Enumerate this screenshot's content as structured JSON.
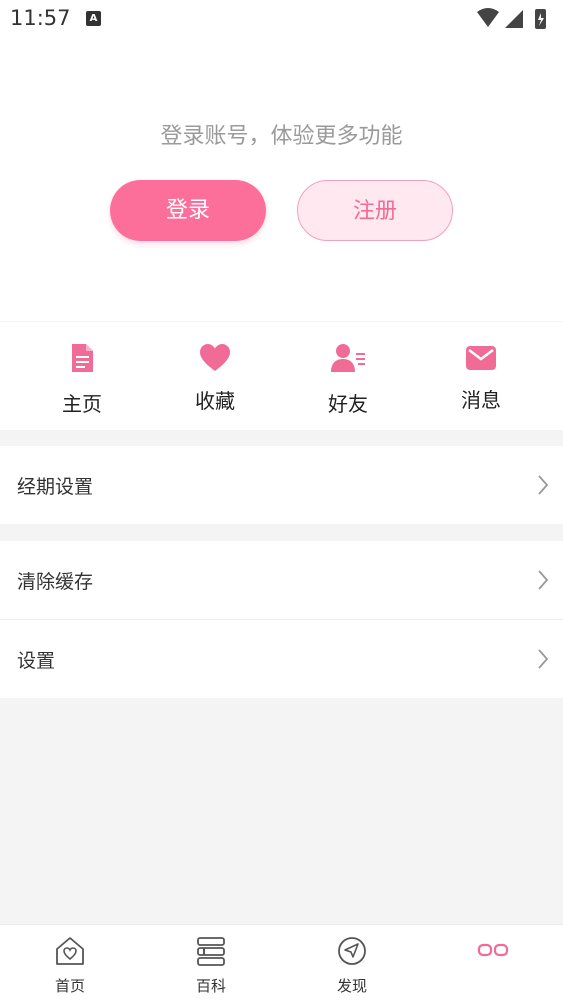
{
  "status_bar": {
    "time": "11:57",
    "notification_icon_letter": "A"
  },
  "header": {
    "prompt": "登录账号，体验更多功能",
    "login_label": "登录",
    "register_label": "注册"
  },
  "quick_actions": [
    {
      "label": "主页",
      "icon": "document-icon"
    },
    {
      "label": "收藏",
      "icon": "heart-icon"
    },
    {
      "label": "好友",
      "icon": "friends-icon"
    },
    {
      "label": "消息",
      "icon": "mail-icon"
    }
  ],
  "menu": [
    {
      "label": "经期设置"
    },
    {
      "label": "清除缓存"
    },
    {
      "label": "设置"
    }
  ],
  "bottom_nav": [
    {
      "label": "首页",
      "icon": "home-heart-icon"
    },
    {
      "label": "百科",
      "icon": "books-icon"
    },
    {
      "label": "发现",
      "icon": "compass-icon"
    },
    {
      "label": "",
      "icon": "profile-rings-icon",
      "active": true
    }
  ],
  "colors": {
    "accent": "#fd6f9b",
    "accent_light": "#ffe8ef",
    "background": "#f4f4f4"
  }
}
